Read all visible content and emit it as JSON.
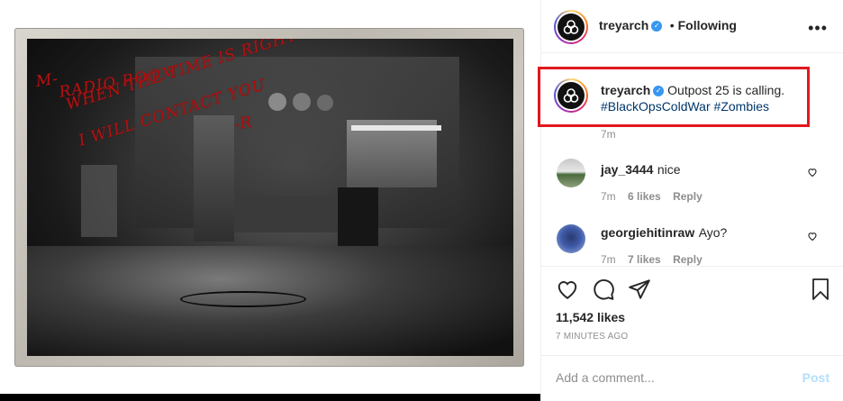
{
  "post": {
    "author": "treyarch",
    "follow_status": "Following",
    "separator": "•",
    "more_icon": "more-horizontal-icon",
    "verified_icon": "verified-badge-icon",
    "note_lines": [
      "M-",
      "RADIO ROOM",
      "WHEN THE TIME IS RIGHT",
      "I WILL CONTACT YOU",
      "-R"
    ],
    "note_color": "#b01414"
  },
  "caption": {
    "author": "treyarch",
    "text": "Outpost 25 is calling.",
    "hashtags": [
      "#BlackOpsColdWar",
      "#Zombies"
    ],
    "time": "7m",
    "highlight_color": "#e0181f"
  },
  "comments": [
    {
      "author": "jay_3444",
      "text": "nice",
      "time": "7m",
      "likes": "6 likes",
      "reply": "Reply"
    },
    {
      "author": "georgiehitinraw",
      "text": "Ayo?",
      "time": "7m",
      "likes": "7 likes",
      "reply": "Reply"
    }
  ],
  "actions": {
    "like_icon": "heart-icon",
    "comment_icon": "comment-icon",
    "share_icon": "send-icon",
    "save_icon": "bookmark-icon",
    "likes": "11,542 likes",
    "time_ago": "7 MINUTES AGO"
  },
  "comment_form": {
    "placeholder": "Add a comment...",
    "value": "",
    "post_label": "Post"
  }
}
